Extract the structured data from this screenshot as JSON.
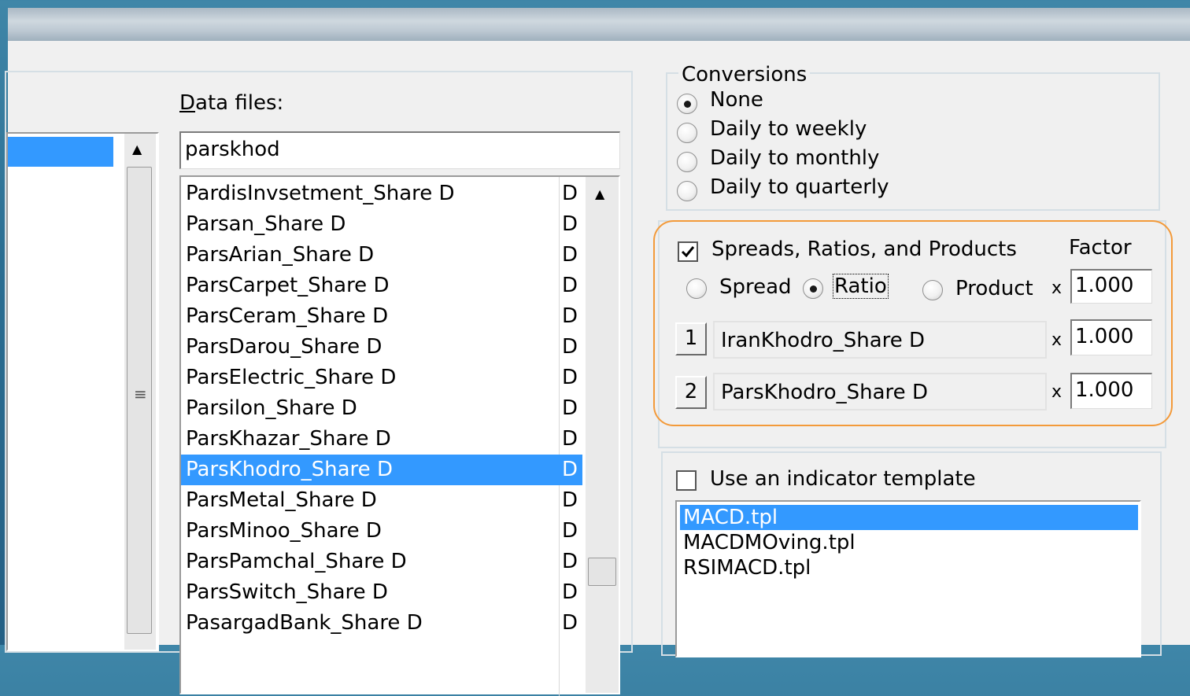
{
  "data_files": {
    "label": "Data files:",
    "label_accel": "D",
    "label_rest": "ata files:",
    "search_value": "parskhod",
    "files": [
      {
        "name": "PardisInvsetment_Share D",
        "type": "D"
      },
      {
        "name": "Parsan_Share D",
        "type": "D"
      },
      {
        "name": "ParsArian_Share D",
        "type": "D"
      },
      {
        "name": "ParsCarpet_Share D",
        "type": "D"
      },
      {
        "name": "ParsCeram_Share D",
        "type": "D"
      },
      {
        "name": "ParsDarou_Share D",
        "type": "D"
      },
      {
        "name": "ParsElectric_Share D",
        "type": "D"
      },
      {
        "name": "Parsilon_Share D",
        "type": "D"
      },
      {
        "name": "ParsKhazar_Share D",
        "type": "D"
      },
      {
        "name": "ParsKhodro_Share D",
        "type": "D"
      },
      {
        "name": "ParsMetal_Share D",
        "type": "D"
      },
      {
        "name": "ParsMinoo_Share D",
        "type": "D"
      },
      {
        "name": "ParsPamchal_Share D",
        "type": "D"
      },
      {
        "name": "ParsSwitch_Share D",
        "type": "D"
      },
      {
        "name": "PasargadBank_Share D",
        "type": "D"
      }
    ],
    "selected_index": 9
  },
  "conversions": {
    "title": "Conversions",
    "options": [
      "None",
      "Daily to weekly",
      "Daily to monthly",
      "Daily to quarterly"
    ],
    "selected_index": 0
  },
  "spreads": {
    "checkbox_label": "Spreads, Ratios, and Products",
    "checked": true,
    "factor_label": "Factor",
    "modes": [
      "Spread",
      "Ratio",
      "Product"
    ],
    "selected_mode_index": 1,
    "times_symbol": "x",
    "result_factor": "1.000",
    "series1_button": "1",
    "series1_name": "IranKhodro_Share D",
    "series1_factor": "1.000",
    "series2_button": "2",
    "series2_name": "ParsKhodro_Share D",
    "series2_factor": "1.000",
    "highlight_color": "#f39a3a"
  },
  "indicator": {
    "checkbox_label": "Use an indicator template",
    "checked": false,
    "templates": [
      "MACD.tpl",
      "MACDMOving.tpl",
      "RSIMACD.tpl"
    ],
    "selected_index": 0
  },
  "colors": {
    "selection": "#3399ff",
    "dialog_bg": "#f0f0f0"
  }
}
